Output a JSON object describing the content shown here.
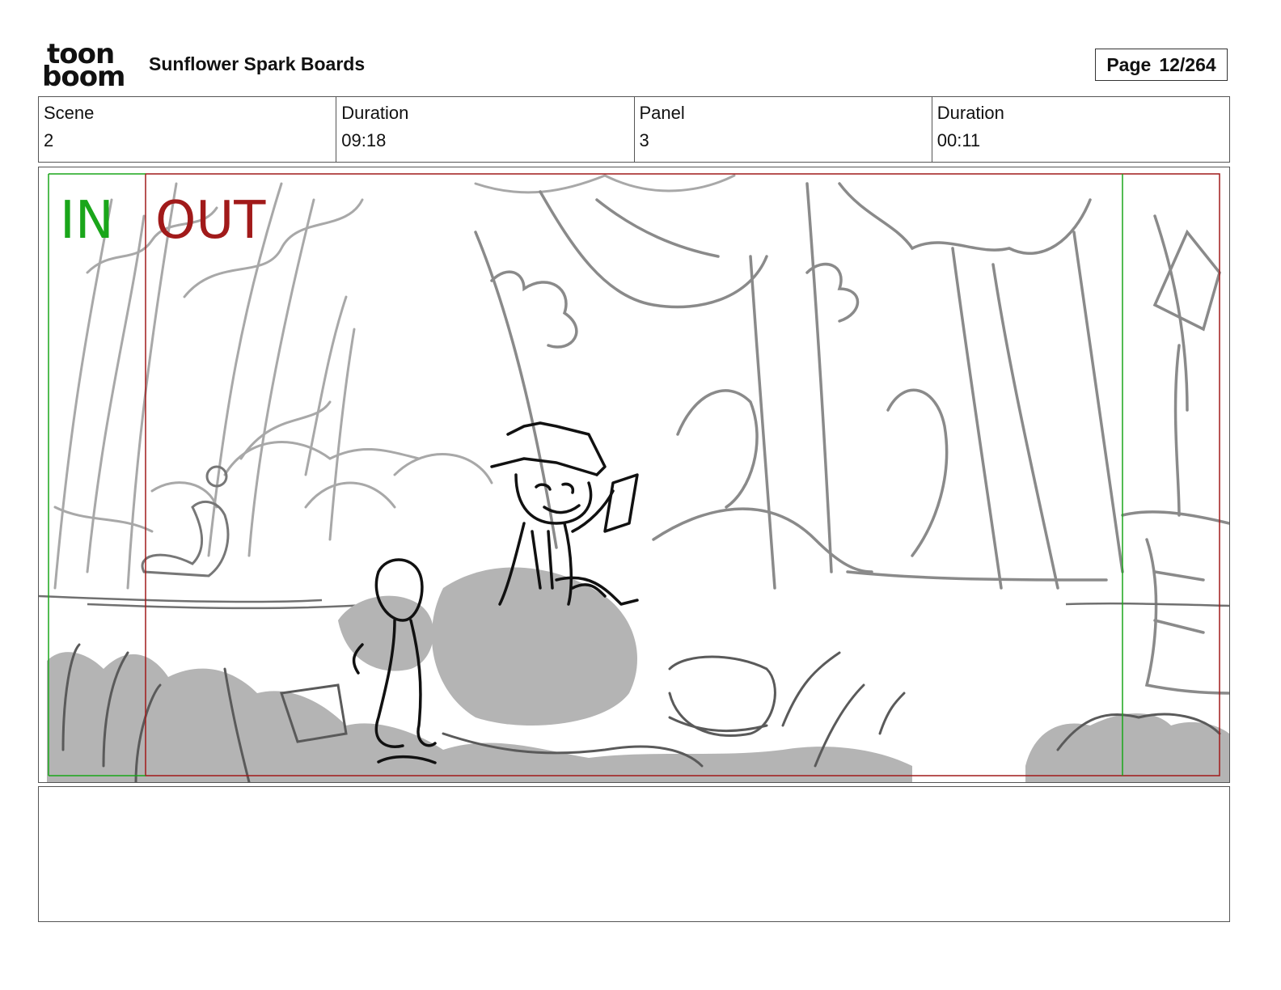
{
  "header": {
    "logo": {
      "line1": "toon",
      "line2": "boom",
      "icon": "toon-boom-logo"
    },
    "app_title": "Sunflower Spark Boards",
    "page": {
      "label": "Page",
      "value": "12/264"
    }
  },
  "info": {
    "scene_label": "Scene",
    "scene_value": "2",
    "scene_duration_label": "Duration",
    "scene_duration_value": "09:18",
    "panel_label": "Panel",
    "panel_value": "3",
    "panel_duration_label": "Duration",
    "panel_duration_value": "00:11"
  },
  "frame": {
    "in_label": "IN",
    "out_label": "OUT",
    "in_color": "#1aa61a",
    "out_color": "#a11a1a",
    "sketch_icon": "storyboard-sketch"
  },
  "notes": {
    "text": ""
  }
}
